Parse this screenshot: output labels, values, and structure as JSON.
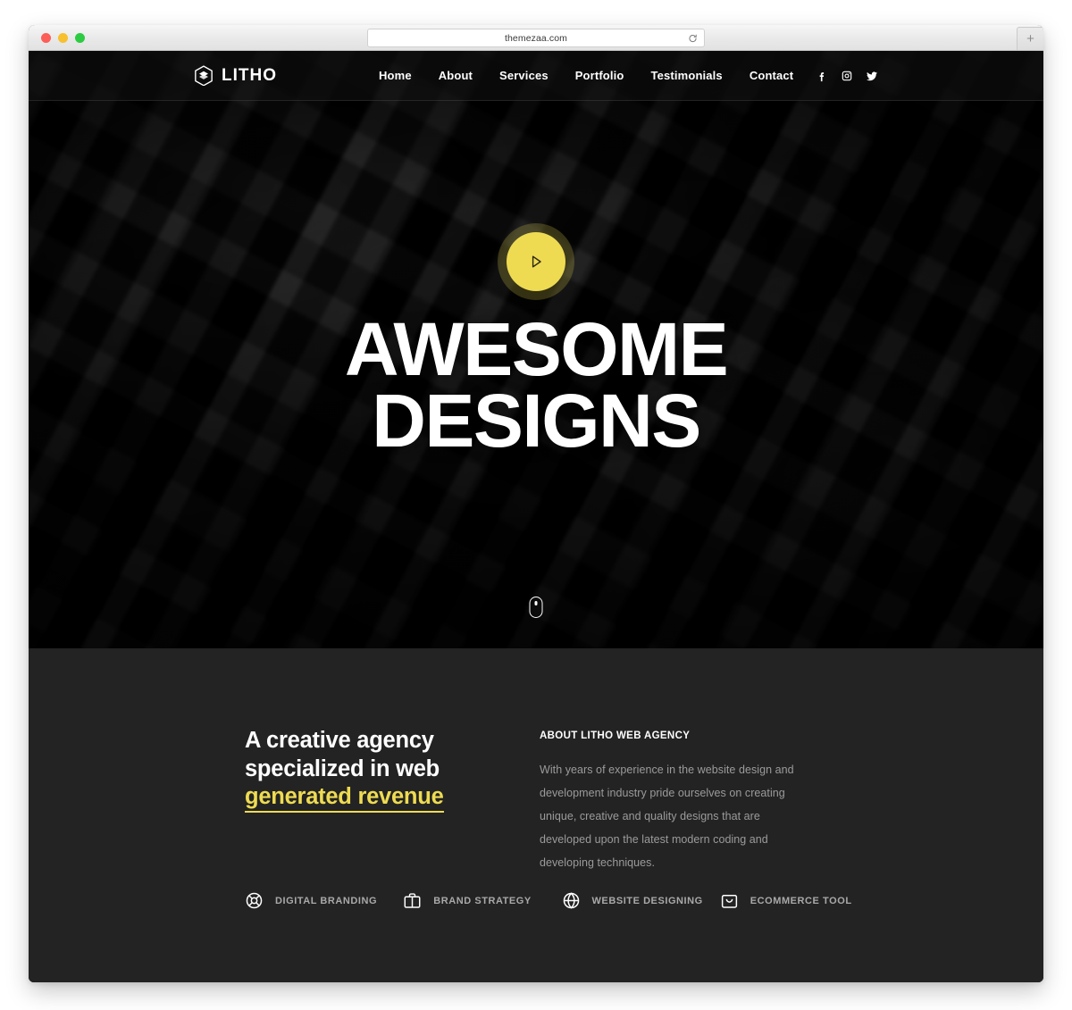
{
  "browser": {
    "url": "themezaa.com",
    "reload_icon": "reload-icon",
    "new_tab_label": "+",
    "traffic_lights": [
      "close",
      "minimize",
      "zoom"
    ]
  },
  "header": {
    "logo_text": "LITHO",
    "logo_icon": "litho-hex-logo-icon",
    "nav": [
      {
        "label": "Home"
      },
      {
        "label": "About"
      },
      {
        "label": "Services"
      },
      {
        "label": "Portfolio"
      },
      {
        "label": "Testimonials"
      },
      {
        "label": "Contact"
      }
    ],
    "socials": [
      {
        "name": "facebook-icon"
      },
      {
        "name": "instagram-icon"
      },
      {
        "name": "twitter-icon"
      }
    ]
  },
  "hero": {
    "play_button_icon": "play-icon",
    "title_line1": "AWESOME",
    "title_line2": "DESIGNS",
    "scroll_indicator_icon": "mouse-scroll-icon",
    "accent_color": "#eedb52"
  },
  "about": {
    "heading_line1": "A creative agency",
    "heading_line2": "specialized in web",
    "heading_highlight": "generated revenue",
    "kicker": "ABOUT LITHO WEB AGENCY",
    "body": "With years of experience in the website design and development industry pride ourselves on creating unique, creative and quality designs that are developed upon the latest modern coding and developing techniques."
  },
  "services": [
    {
      "label": "DIGITAL BRANDING",
      "icon": "lifebuoy-icon"
    },
    {
      "label": "BRAND STRATEGY",
      "icon": "briefcase-icon"
    },
    {
      "label": "WEBSITE DESIGNING",
      "icon": "globe-icon"
    },
    {
      "label": "ECOMMERCE TOOL",
      "icon": "shopping-bag-icon"
    }
  ]
}
